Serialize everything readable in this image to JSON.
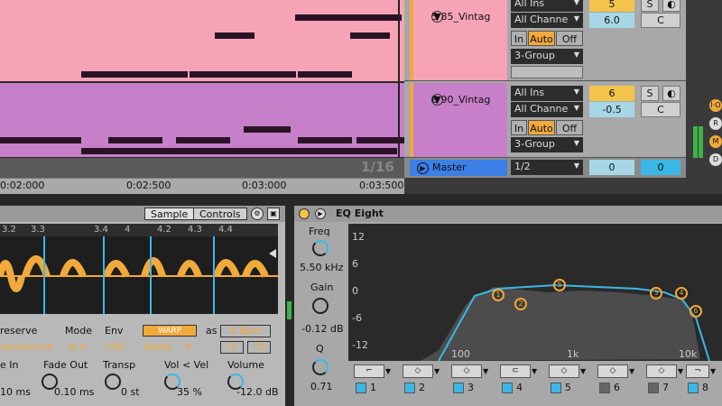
{
  "arrangement": {
    "time_ruler": [
      "0:02:000",
      "0:02:500",
      "0:03:000",
      "0:03:500"
    ],
    "page_indicator": "1/16"
  },
  "mixer": {
    "tracks": [
      {
        "name": "5 85_Vintag",
        "input": "All Ins",
        "channel": "All Channe",
        "monitor": [
          "In",
          "Auto",
          "Off"
        ],
        "output": "3-Group",
        "volume": "5",
        "pan": "6.0",
        "send": "C"
      },
      {
        "name": "6 90_Vintag",
        "input": "All Ins",
        "channel": "All Channe",
        "monitor": [
          "In",
          "Auto",
          "Off"
        ],
        "output": "3-Group",
        "volume": "6",
        "pan": "-0.5",
        "send": "C"
      }
    ],
    "solo_label": "S",
    "master": {
      "name": "Master",
      "cue": "1/2",
      "vol_a": "0",
      "vol_b": "0"
    }
  },
  "sampler": {
    "tabs": [
      "Sample",
      "Controls"
    ],
    "wave_ruler": [
      "3.2",
      "3.3",
      "3.4",
      "4",
      "4.2",
      "4.3",
      "4.4"
    ],
    "row1_labels": {
      "preserve": "reserve",
      "mode": "Mode",
      "env": "Env",
      "warp": "WARP",
      "as": "as",
      "bars": "4 Bars"
    },
    "row1_values": {
      "transients": "ransients",
      "env": "100",
      "beats": "Beats",
      "half": ":2",
      "double": "*2"
    },
    "row2_labels": {
      "fadein": "e In",
      "fadeout": "Fade Out",
      "transp": "Transp",
      "volvel": "Vol < Vel",
      "volume": "Volume"
    },
    "row2_values": {
      "fadein": "10 ms",
      "fadeout": "0.10 ms",
      "transp": "0 st",
      "volvel": "35 %",
      "volume": "-12.0 dB"
    }
  },
  "eq": {
    "title": "EQ Eight",
    "freq_label": "Freq",
    "freq_value": "5.50 kHz",
    "gain_label": "Gain",
    "gain_value": "-0.12 dB",
    "q_label": "Q",
    "q_value": "0.71",
    "db_scale": [
      "12",
      "6",
      "0",
      "-6",
      "-12"
    ],
    "freq_scale": [
      "100",
      "1k",
      "10k"
    ],
    "points": [
      "1",
      "2",
      "3",
      "4",
      "5",
      "6",
      "7",
      "8"
    ],
    "bands": [
      {
        "num": "1",
        "active": true
      },
      {
        "num": "2",
        "active": true
      },
      {
        "num": "3",
        "active": true
      },
      {
        "num": "4",
        "active": true
      },
      {
        "num": "5",
        "active": true
      },
      {
        "num": "6",
        "active": false
      },
      {
        "num": "7",
        "active": false
      },
      {
        "num": "8",
        "active": true
      }
    ]
  },
  "colors": {
    "accent": "#3bb7e6",
    "warp": "#f2a93b",
    "lane1": "#f6a3b6",
    "lane2": "#c77fc9",
    "master": "#3c7fe6"
  }
}
